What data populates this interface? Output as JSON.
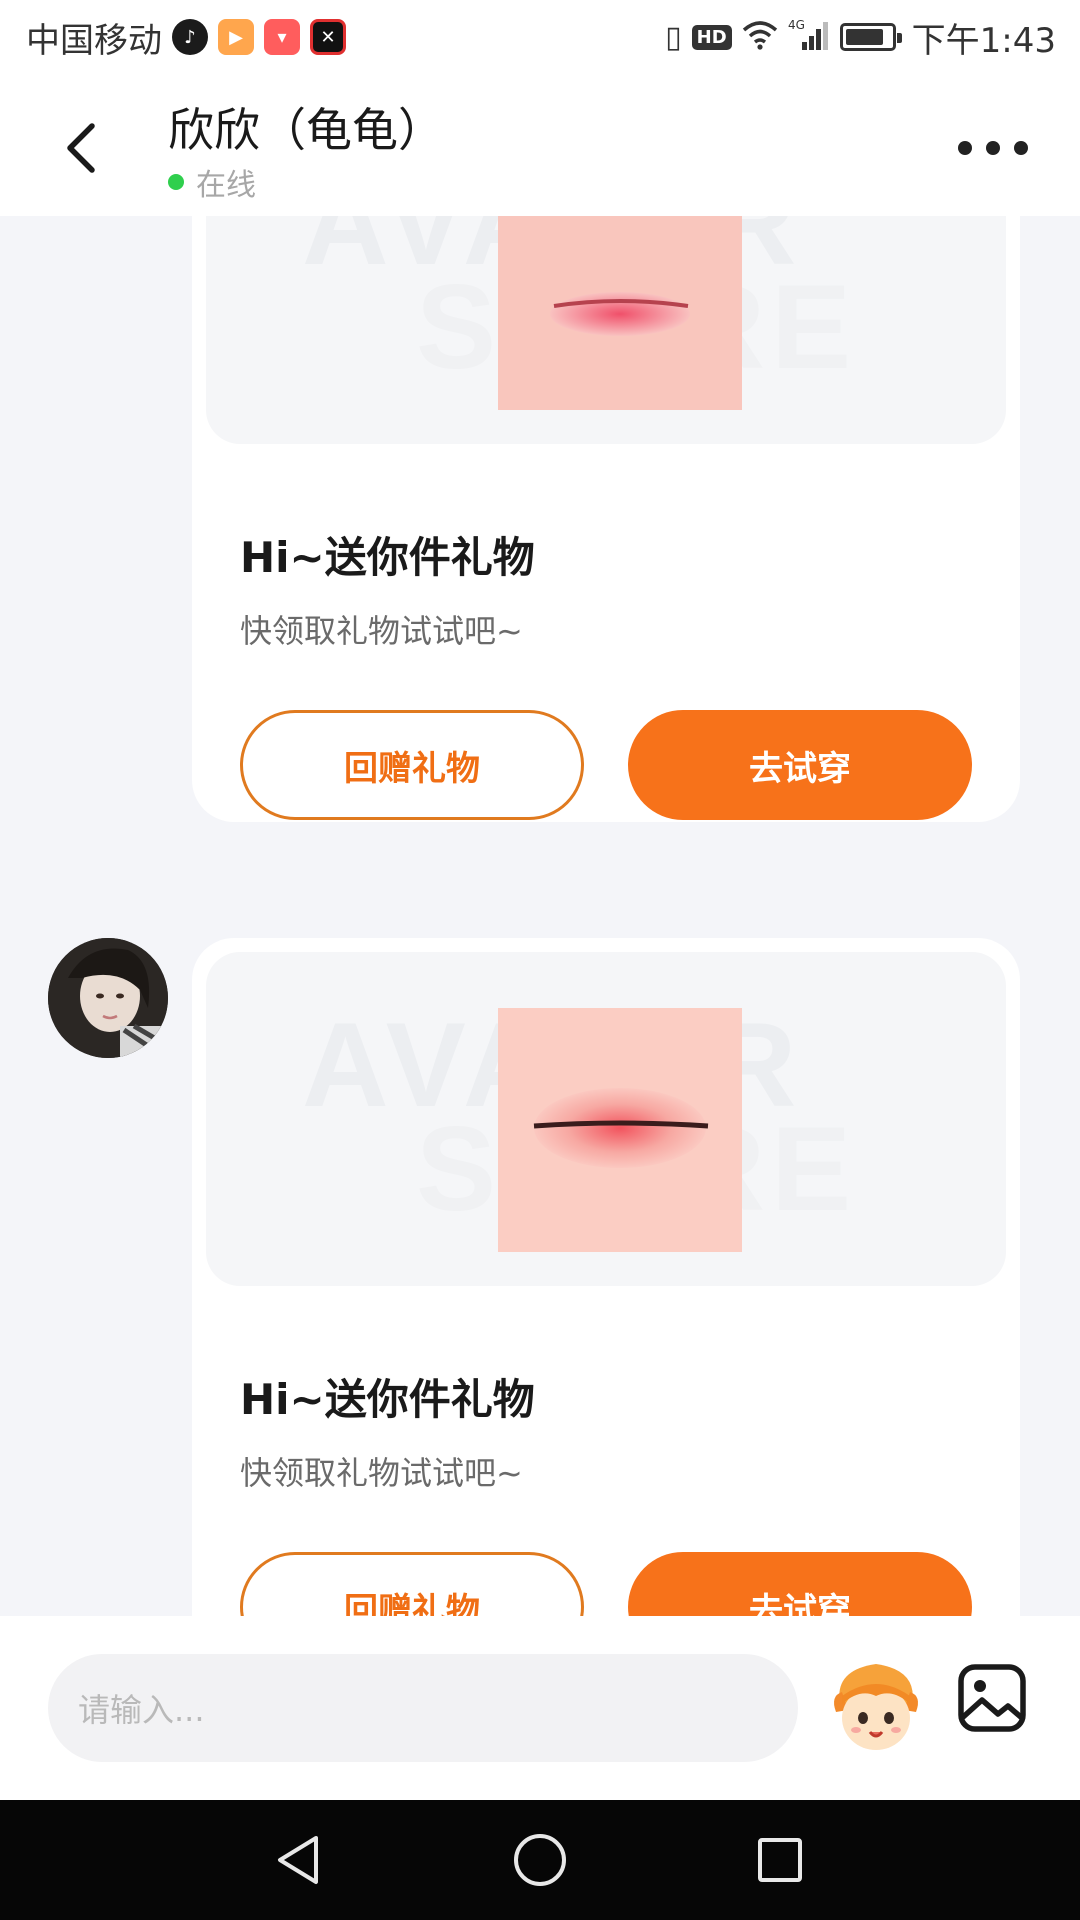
{
  "status_bar": {
    "carrier": "中国移动",
    "network": "4G",
    "clock": "下午1:43",
    "hd_label": "HD",
    "battery_level": 0.85,
    "icons": [
      "tiktok-icon",
      "video-app-icon",
      "shop-app-icon",
      "capcut-icon",
      "vibrate-icon",
      "hd-icon",
      "wifi-icon",
      "signal-icon",
      "battery-icon"
    ]
  },
  "header": {
    "title": "欣欣（龟龟）",
    "status": "在线",
    "status_color": "#2fcf4d",
    "icons": [
      "back-arrow-icon",
      "more-icon"
    ]
  },
  "messages": [
    {
      "title": "Hi~送你件礼物",
      "subtitle": "快领取礼物试试吧~",
      "return_gift_label": "回赠礼物",
      "try_on_label": "去试穿",
      "watermark_line1": "AVATAR",
      "watermark_line2": "STORE"
    },
    {
      "title": "Hi~送你件礼物",
      "subtitle": "快领取礼物试试吧~",
      "return_gift_label": "回赠礼物",
      "try_on_label": "去试穿",
      "watermark_line1": "AVATAR",
      "watermark_line2": "STORE"
    }
  ],
  "input_bar": {
    "placeholder": "请输入...",
    "icons": [
      "emoji-mascot-icon",
      "image-icon"
    ]
  },
  "nav_bar": {
    "icons": [
      "nav-back-icon",
      "nav-home-icon",
      "nav-recent-icon"
    ]
  },
  "colors": {
    "accent": "#f7721a",
    "accent_outline": "#e07a1f",
    "background": "#f4f5f9",
    "card": "#ffffff"
  }
}
